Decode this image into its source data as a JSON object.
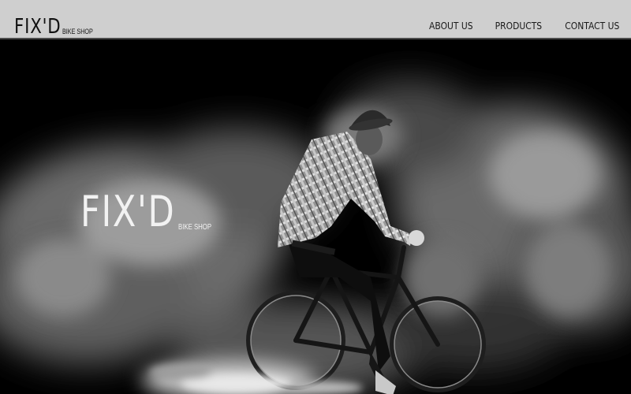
{
  "header": {
    "logo": {
      "main": "FIX'D",
      "sub": "BIKE SHOP"
    },
    "nav": [
      {
        "label": "ABOUT US"
      },
      {
        "label": "PRODUCTS"
      },
      {
        "label": "CONTACT US"
      }
    ]
  },
  "hero": {
    "logo": {
      "main": "FIX'D",
      "sub": "BIKE SHOP"
    },
    "image": "cyclist-in-smoke-photo"
  },
  "colors": {
    "header_bg": "#cfcfcf",
    "header_text": "#111111",
    "hero_bg": "#000000",
    "hero_text": "#f2f2f2"
  }
}
